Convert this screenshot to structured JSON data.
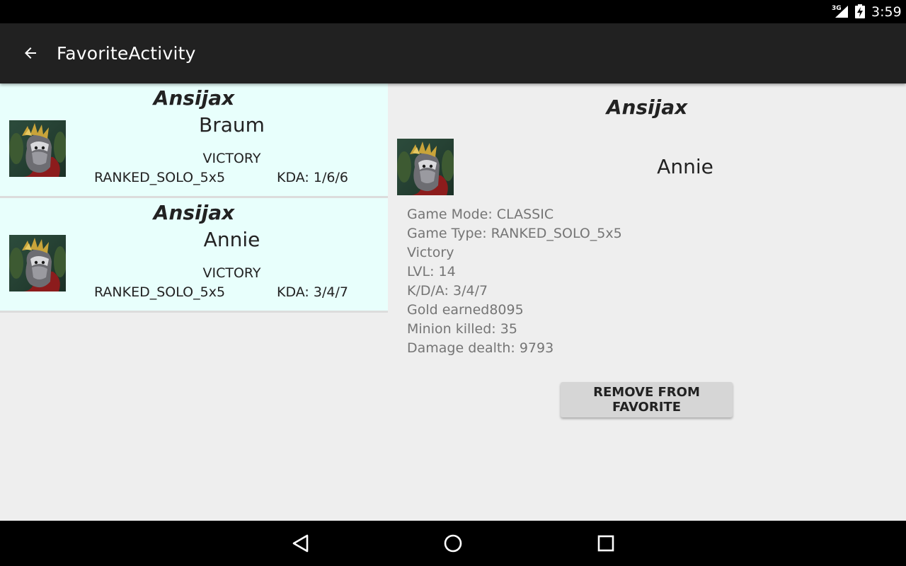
{
  "status_bar": {
    "network": "3G",
    "time": "3:59"
  },
  "toolbar": {
    "back_icon": "arrow-back-icon",
    "title": "FavoriteActivity"
  },
  "favorites": [
    {
      "summoner": "Ansijax",
      "champion": "Braum",
      "result": "VICTORY",
      "queue": "RANKED_SOLO_5x5",
      "kda": "KDA: 1/6/6"
    },
    {
      "summoner": "Ansijax",
      "champion": "Annie",
      "result": "VICTORY",
      "queue": "RANKED_SOLO_5x5",
      "kda": "KDA: 3/4/7"
    }
  ],
  "detail": {
    "summoner": "Ansijax",
    "champion": "Annie",
    "stats": [
      "Game Mode: CLASSIC",
      "Game Type: RANKED_SOLO_5x5",
      "Victory",
      "LVL: 14",
      "K/D/A: 3/4/7",
      "Gold earned8095",
      "Minion killed: 35",
      "Damage dealth: 9793"
    ],
    "remove_label": "REMOVE FROM FAVORITE"
  },
  "colors": {
    "toolbar": "#212121",
    "card_background": "#e8fffc",
    "content_background": "#eeeeee",
    "stat_text": "#757575"
  },
  "nav_bar": {
    "icons": [
      "back-triangle-icon",
      "home-circle-icon",
      "recents-square-icon"
    ]
  }
}
